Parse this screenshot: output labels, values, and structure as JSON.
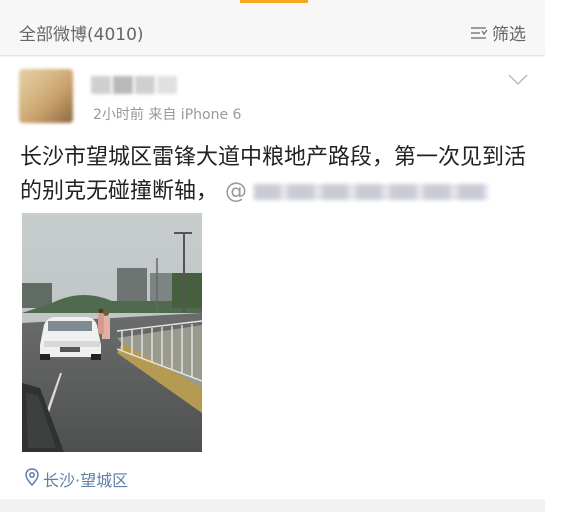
{
  "header": {
    "feed_title": "全部微博(4010)",
    "filter_label": "筛选",
    "filter_icon": "filter-icon",
    "accent_color": "#f5a623"
  },
  "post": {
    "username": "",
    "meta_text": "2小时前  来自 iPhone 6",
    "text": "长沙市望城区雷锋大道中粮地产路段，第一次见到活的别克无碰撞断轴，",
    "mention_prefix": "@",
    "photo_icon": "street-photo",
    "location_icon": "location-pin-icon",
    "location": "长沙·望城区",
    "link_color": "#5d7ea8"
  }
}
